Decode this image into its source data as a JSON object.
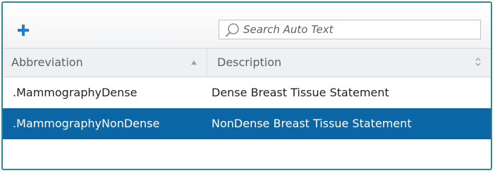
{
  "toolbar": {
    "add_icon": "plus-icon",
    "search": {
      "placeholder": "Search Auto Text",
      "value": "",
      "icon": "search-icon"
    }
  },
  "table": {
    "columns": [
      {
        "label": "Abbreviation",
        "sort": "ascending"
      },
      {
        "label": "Description",
        "sort": "none"
      }
    ],
    "rows": [
      {
        "abbreviation": ".MammographyDense",
        "description": "Dense Breast Tissue Statement",
        "selected": false
      },
      {
        "abbreviation": ".MammographyNonDense",
        "description": "NonDense Breast Tissue Statement",
        "selected": true
      }
    ]
  },
  "colors": {
    "border": "#2e8a8f",
    "accent": "#1e7fd0",
    "selected_row": "#0b66a6"
  }
}
